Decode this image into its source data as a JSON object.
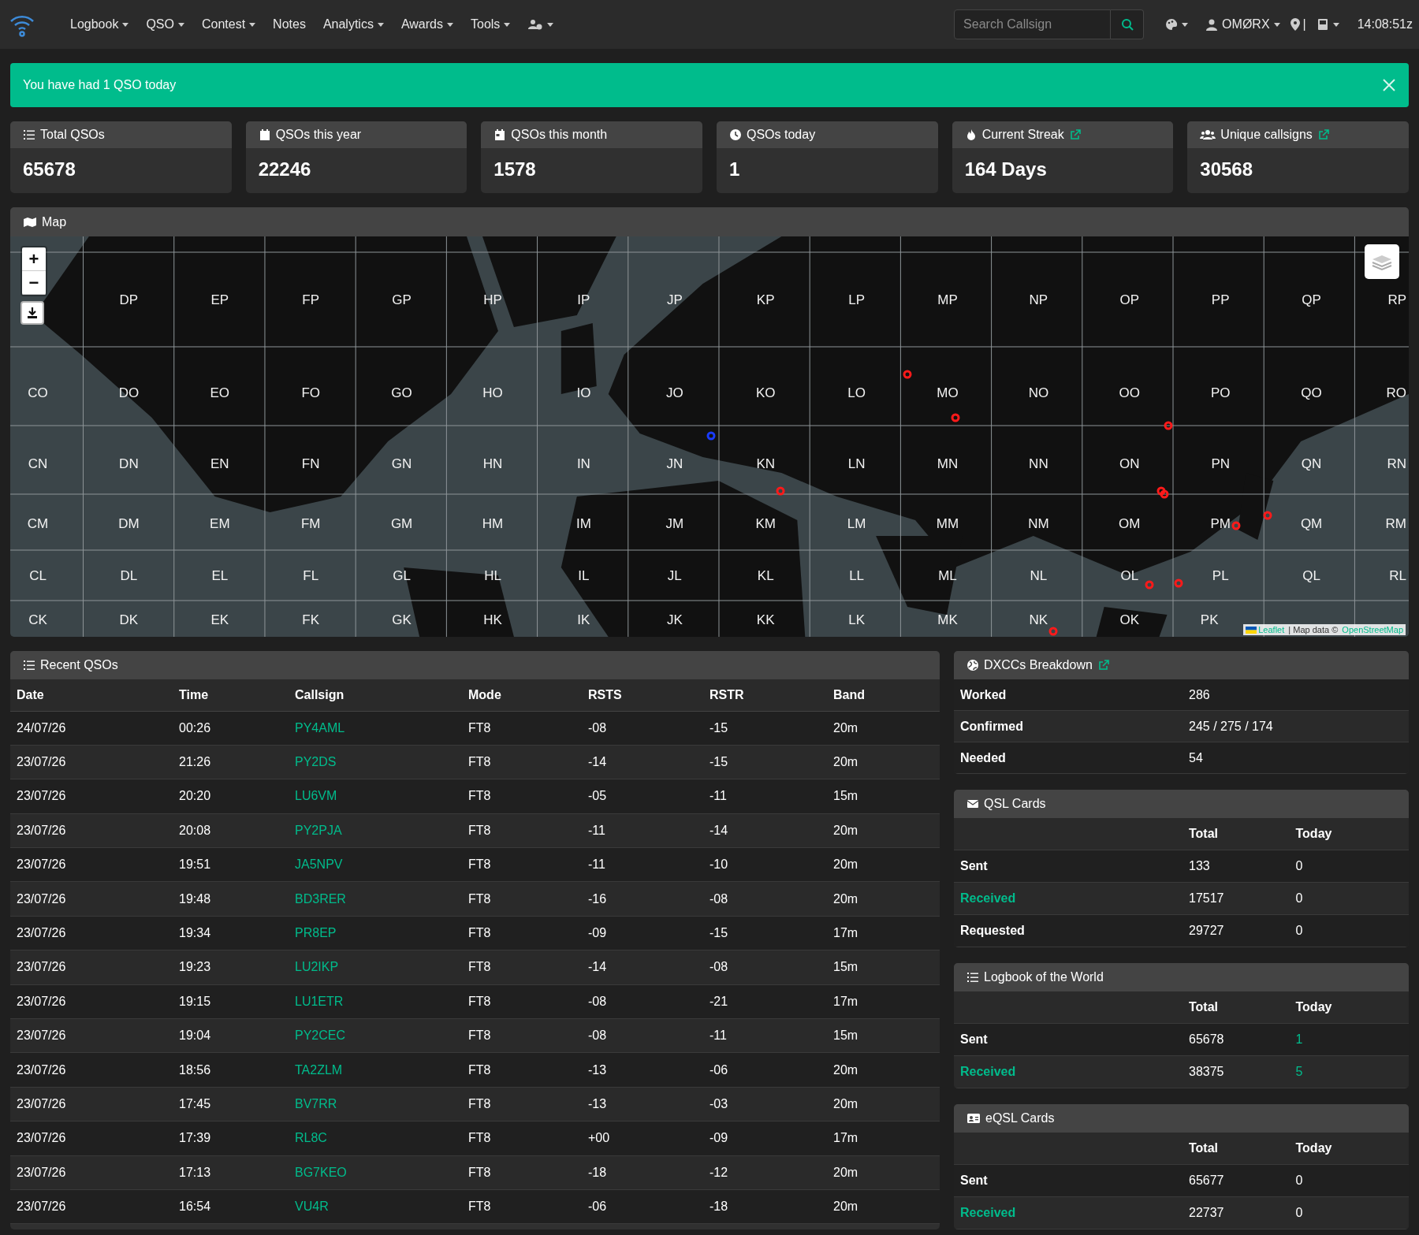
{
  "nav": {
    "menu": [
      {
        "label": "Logbook",
        "dropdown": true
      },
      {
        "label": "QSO",
        "dropdown": true
      },
      {
        "label": "Contest",
        "dropdown": true
      },
      {
        "label": "Notes",
        "dropdown": false
      },
      {
        "label": "Analytics",
        "dropdown": true
      },
      {
        "label": "Awards",
        "dropdown": true
      },
      {
        "label": "Tools",
        "dropdown": true
      }
    ],
    "search": {
      "placeholder": "Search Callsign"
    },
    "user": "OMØRX",
    "separator": "|",
    "clock": "14:08:51z"
  },
  "alert": {
    "text": "You have had 1 QSO today"
  },
  "stats": [
    {
      "title": "Total QSOs",
      "value": "65678",
      "external_link": false
    },
    {
      "title": "QSOs this year",
      "value": "22246",
      "external_link": false
    },
    {
      "title": "QSOs this month",
      "value": "1578",
      "external_link": false
    },
    {
      "title": "QSOs today",
      "value": "1",
      "external_link": false
    },
    {
      "title": "Current Streak",
      "value": "164 Days",
      "external_link": true
    },
    {
      "title": "Unique callsigns",
      "value": "30568",
      "external_link": true
    }
  ],
  "map": {
    "title": "Map",
    "kind": "picture",
    "grid_labels": [
      [
        "DP",
        "EP",
        "FP",
        "GP",
        "HP",
        "IP",
        "JP",
        "KP",
        "LP",
        "MP",
        "NP",
        "OP",
        "PP",
        "QP",
        "RP"
      ],
      [
        "CO",
        "DO",
        "EO",
        "FO",
        "GO",
        "HO",
        "IO",
        "JO",
        "KO",
        "LO",
        "MO",
        "NO",
        "OO",
        "PO",
        "QO",
        "RO"
      ],
      [
        "CN",
        "DN",
        "EN",
        "FN",
        "GN",
        "HN",
        "IN",
        "JN",
        "KN",
        "LN",
        "MN",
        "NN",
        "ON",
        "PN",
        "QN",
        "RN"
      ],
      [
        "CM",
        "DM",
        "EM",
        "FM",
        "GM",
        "HM",
        "IM",
        "JM",
        "KM",
        "LM",
        "MM",
        "NM",
        "OM",
        "PM",
        "QM",
        "RM"
      ],
      [
        "CL",
        "DL",
        "EL",
        "FL",
        "GL",
        "HL",
        "IL",
        "JL",
        "KL",
        "LL",
        "ML",
        "NL",
        "OL",
        "PL",
        "QL",
        "RL"
      ],
      [
        "CK",
        "DK",
        "EK",
        "FK",
        "GK",
        "HK",
        "IK",
        "JK",
        "KK",
        "LK",
        "MK",
        "NK",
        "OK",
        "PK"
      ]
    ],
    "zoom_in": "+",
    "zoom_out": "−",
    "attribution": {
      "leaflet": "Leaflet",
      "text": " | Map data © ",
      "osm": "OpenStreetMap"
    }
  },
  "recent": {
    "title": "Recent QSOs",
    "columns": [
      "Date",
      "Time",
      "Callsign",
      "Mode",
      "RSTS",
      "RSTR",
      "Band"
    ],
    "rows": [
      [
        "24/07/26",
        "00:26",
        "PY4AML",
        "FT8",
        "-08",
        "-15",
        "20m"
      ],
      [
        "23/07/26",
        "21:26",
        "PY2DS",
        "FT8",
        "-14",
        "-15",
        "20m"
      ],
      [
        "23/07/26",
        "20:20",
        "LU6VM",
        "FT8",
        "-05",
        "-11",
        "15m"
      ],
      [
        "23/07/26",
        "20:08",
        "PY2PJA",
        "FT8",
        "-11",
        "-14",
        "20m"
      ],
      [
        "23/07/26",
        "19:51",
        "JA5NPV",
        "FT8",
        "-11",
        "-10",
        "20m"
      ],
      [
        "23/07/26",
        "19:48",
        "BD3RER",
        "FT8",
        "-16",
        "-08",
        "20m"
      ],
      [
        "23/07/26",
        "19:34",
        "PR8EP",
        "FT8",
        "-09",
        "-15",
        "17m"
      ],
      [
        "23/07/26",
        "19:23",
        "LU2IKP",
        "FT8",
        "-14",
        "-08",
        "15m"
      ],
      [
        "23/07/26",
        "19:15",
        "LU1ETR",
        "FT8",
        "-08",
        "-21",
        "17m"
      ],
      [
        "23/07/26",
        "19:04",
        "PY2CEC",
        "FT8",
        "-08",
        "-11",
        "15m"
      ],
      [
        "23/07/26",
        "18:56",
        "TA2ZLM",
        "FT8",
        "-13",
        "-06",
        "20m"
      ],
      [
        "23/07/26",
        "17:45",
        "BV7RR",
        "FT8",
        "-13",
        "-03",
        "20m"
      ],
      [
        "23/07/26",
        "17:39",
        "RL8C",
        "FT8",
        "+00",
        "-09",
        "17m"
      ],
      [
        "23/07/26",
        "17:13",
        "BG7KEO",
        "FT8",
        "-18",
        "-12",
        "20m"
      ],
      [
        "23/07/26",
        "16:54",
        "VU4R",
        "FT8",
        "-06",
        "-18",
        "20m"
      ]
    ]
  },
  "dxcc": {
    "title": "DXCCs Breakdown",
    "external_link": true,
    "rows": [
      {
        "label": "Worked",
        "value": "286"
      },
      {
        "label": "Confirmed",
        "value": "245 / 275 / 174"
      },
      {
        "label": "Needed",
        "value": "54"
      }
    ]
  },
  "panels": [
    {
      "title": "QSL Cards",
      "columns": [
        "Total",
        "Today"
      ],
      "rows": [
        {
          "label": "Sent",
          "highlight": false,
          "total": "133",
          "today": "0",
          "today_highlight": false
        },
        {
          "label": "Received",
          "highlight": true,
          "total": "17517",
          "today": "0",
          "today_highlight": false
        },
        {
          "label": "Requested",
          "highlight": false,
          "total": "29727",
          "today": "0",
          "today_highlight": false
        }
      ]
    },
    {
      "title": "Logbook of the World",
      "columns": [
        "Total",
        "Today"
      ],
      "rows": [
        {
          "label": "Sent",
          "highlight": false,
          "total": "65678",
          "today": "1",
          "today_highlight": true
        },
        {
          "label": "Received",
          "highlight": true,
          "total": "38375",
          "today": "5",
          "today_highlight": true
        }
      ]
    },
    {
      "title": "eQSL Cards",
      "columns": [
        "Total",
        "Today"
      ],
      "rows": [
        {
          "label": "Sent",
          "highlight": false,
          "total": "65677",
          "today": "0",
          "today_highlight": false
        },
        {
          "label": "Received",
          "highlight": true,
          "total": "22737",
          "today": "0",
          "today_highlight": false
        }
      ]
    }
  ]
}
